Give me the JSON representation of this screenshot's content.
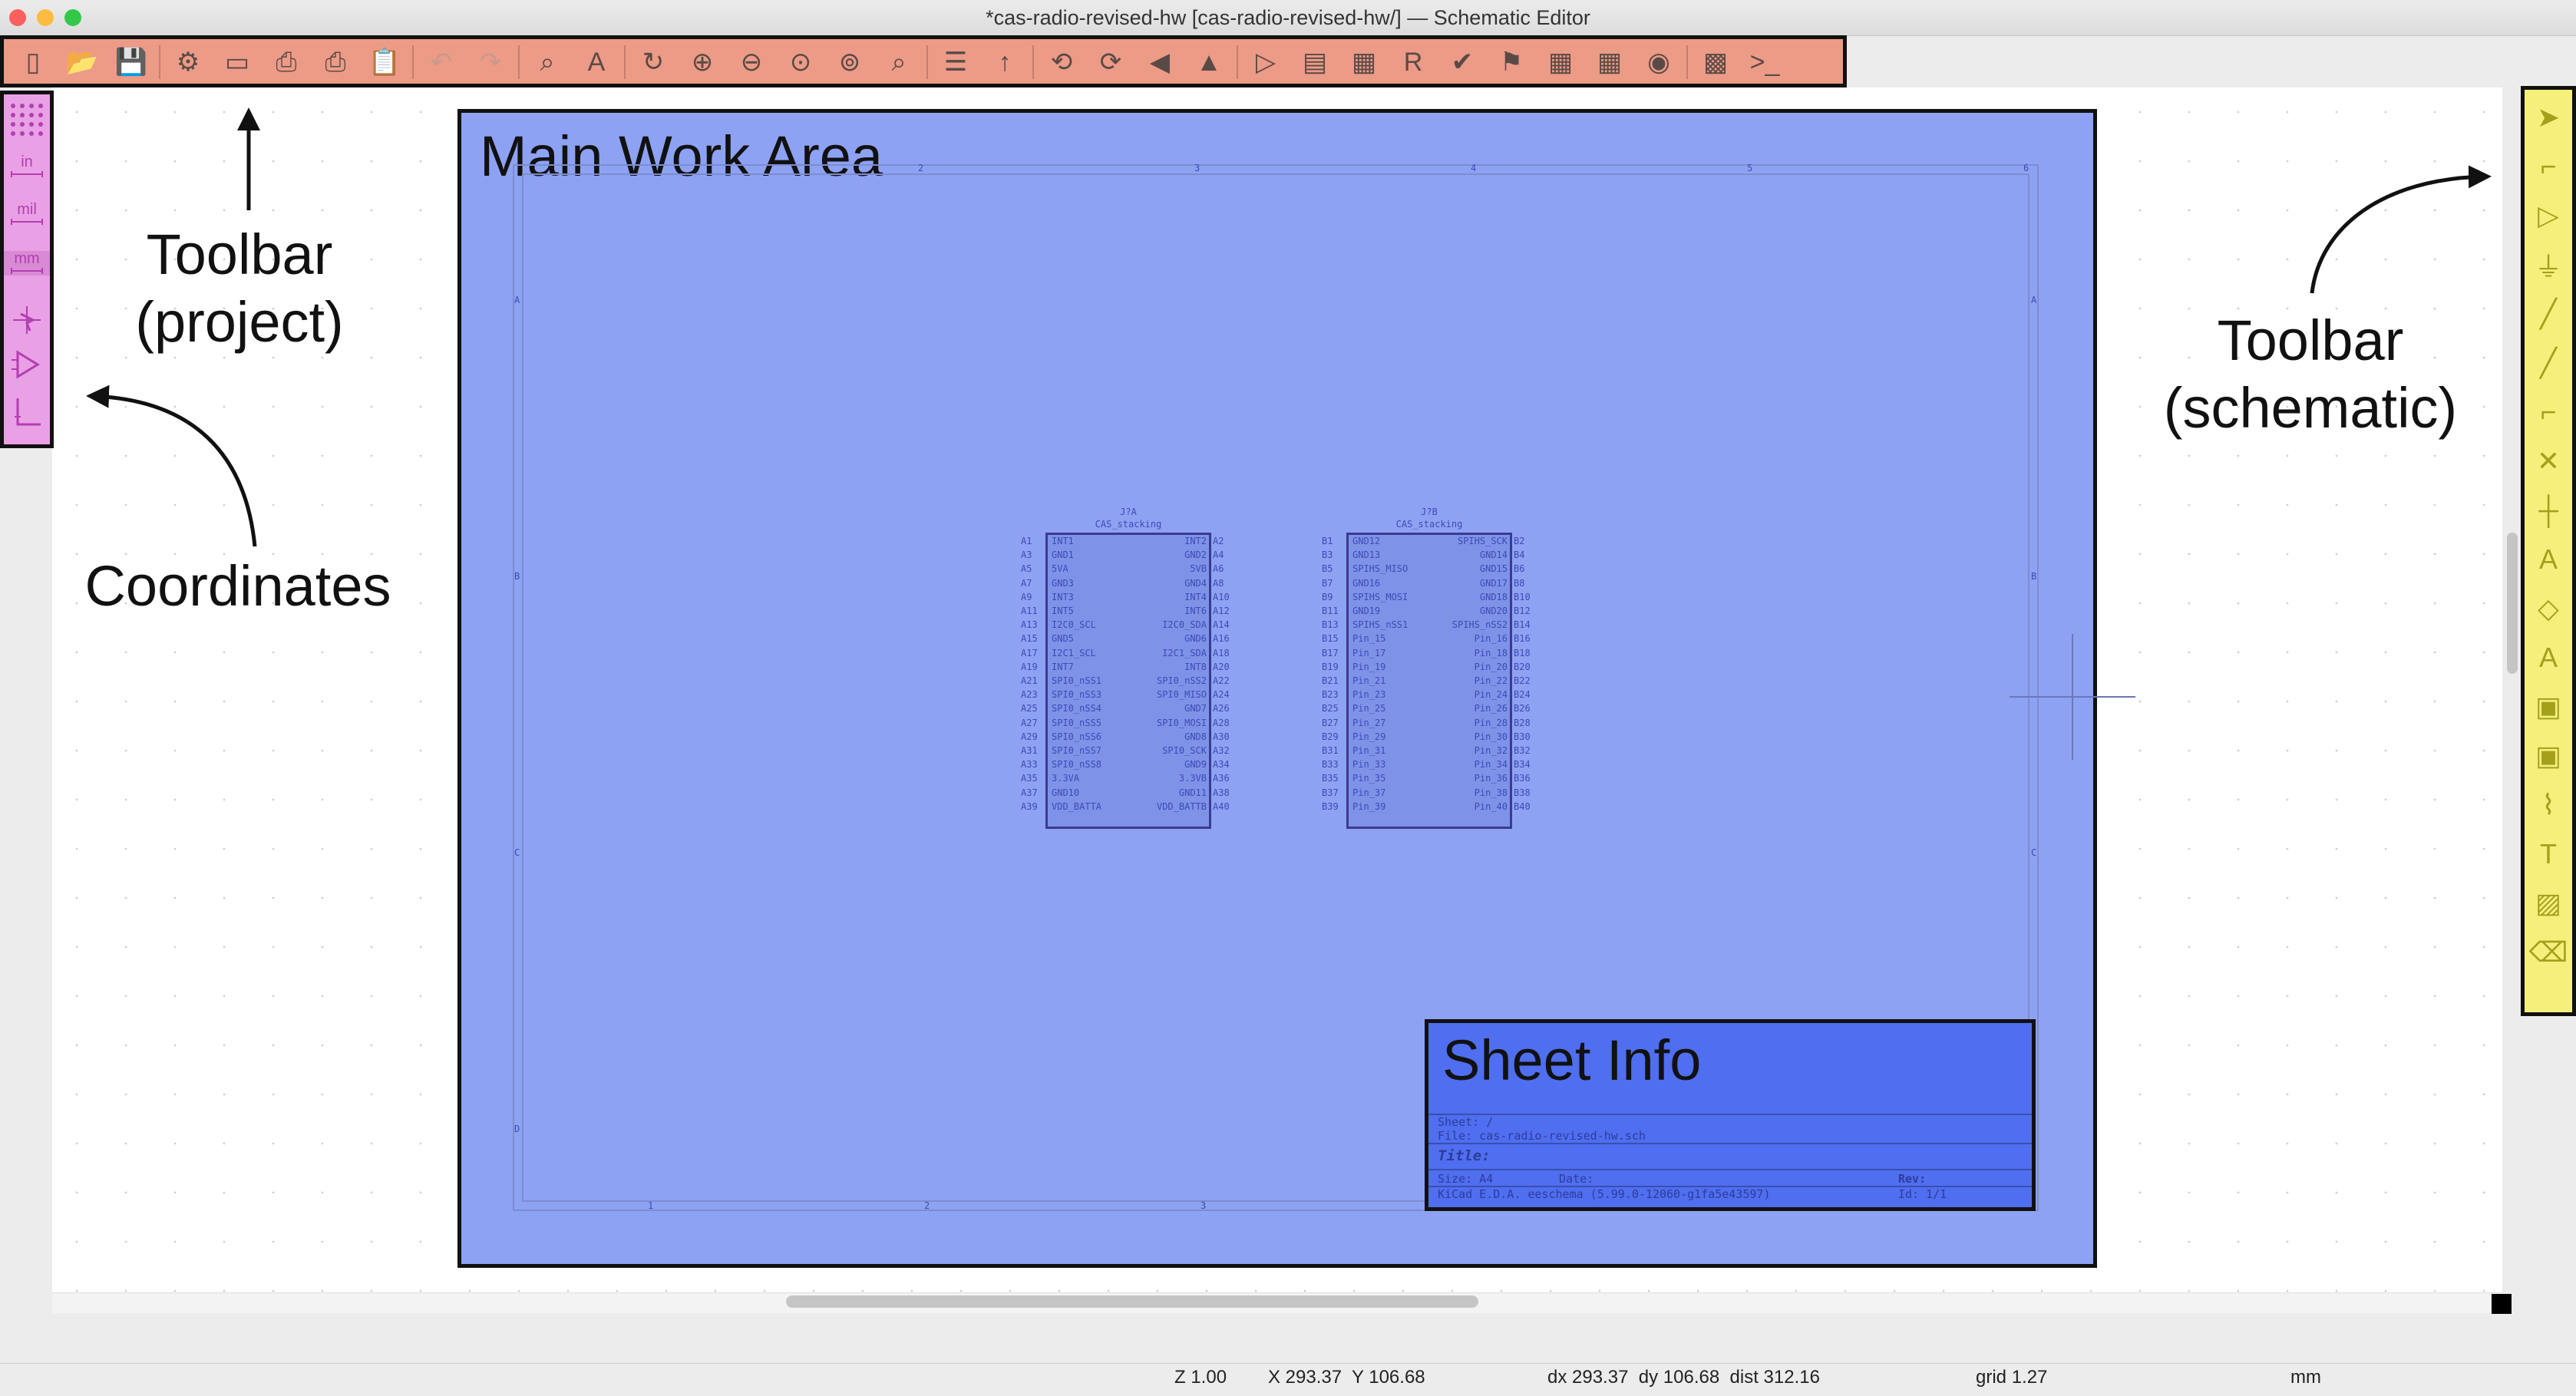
{
  "window": {
    "title": "*cas-radio-revised-hw [cas-radio-revised-hw/] — Schematic Editor"
  },
  "colors": {
    "toolbar_project": "#ec9b87",
    "coordinates_panel": "#eaa0e5",
    "toolbar_schematic": "#f5f07c",
    "main_work_area": "#8ea2f3",
    "sheet_info": "#4f6ef0"
  },
  "toolbar_project": {
    "icons": [
      "new-schematic-icon",
      "open-icon",
      "save-icon",
      "schematic-setup-icon",
      "page-settings-icon",
      "print-icon",
      "plot-icon",
      "paste-icon",
      "undo-icon",
      "redo-icon",
      "find-icon",
      "find-replace-icon",
      "refresh-icon",
      "zoom-in-icon",
      "zoom-out-icon",
      "zoom-fit-icon",
      "zoom-objects-icon",
      "zoom-selection-icon",
      "hierarchy-navigator-icon",
      "leave-sheet-icon",
      "rotate-ccw-icon",
      "rotate-cw-icon",
      "mirror-vertical-icon",
      "mirror-horizontal-icon",
      "symbol-editor-icon",
      "symbol-library-browser-icon",
      "footprint-assignment-icon",
      "annotate-icon",
      "erc-icon",
      "assign-footprints-icon",
      "bom-icon",
      "edit-fields-icon",
      "generate-bom-icon",
      "pcb-editor-icon",
      "scripting-console-icon"
    ]
  },
  "annotations": {
    "main_work_area": "Main Work Area",
    "sheet_info": "Sheet Info",
    "toolbar_project_line1": "Toolbar",
    "toolbar_project_line2": "(project)",
    "toolbar_schematic_line1": "Toolbar",
    "toolbar_schematic_line2": "(schematic)",
    "coordinates": "Coordinates"
  },
  "coordinates_panel": {
    "icons": [
      "grid-toggle-icon",
      "units-inches-icon",
      "units-mils-icon",
      "units-mm-icon",
      "cursor-shape-icon",
      "hidden-pins-icon",
      "wire-angle-icon"
    ],
    "unit_labels": [
      "in",
      "mil",
      "mm"
    ]
  },
  "toolbar_schematic": {
    "icons": [
      "select-icon",
      "highlight-net-icon",
      "add-symbol-icon",
      "add-power-icon",
      "add-wire-icon",
      "add-bus-icon",
      "add-wire-to-bus-entry-icon",
      "no-connect-icon",
      "add-junction-icon",
      "add-label-icon",
      "add-global-label-icon",
      "add-hierarchical-label-icon",
      "add-sheet-icon",
      "import-sheet-pin-icon",
      "add-graphic-lines-icon",
      "add-text-icon",
      "add-image-icon",
      "delete-icon"
    ]
  },
  "sheet_info": {
    "sheet": "Sheet: /",
    "file": "File: cas-radio-revised-hw.sch",
    "title": "Title:",
    "size": "Size: A4",
    "date": "Date:",
    "rev": "Rev:",
    "app": "KiCad E.D.A.  eeschema (5.99.0-12060-g1fa5e43597)",
    "id": "Id: 1/1"
  },
  "components": [
    {
      "ref": "J?A",
      "value": "CAS_stacking",
      "left_pins": [
        "INT1",
        "GND1",
        "5VA",
        "GND3",
        "INT3",
        "INT5",
        "I2C0_SCL",
        "GND5",
        "I2C1_SCL",
        "INT7",
        "SPI0_nSS1",
        "SPI0_nSS3",
        "SPI0_nSS4",
        "SPI0_nSS5",
        "SPI0_nSS6",
        "SPI0_nSS7",
        "SPI0_nSS8",
        "3.3VA",
        "GND10",
        "VDD_BATTA"
      ],
      "right_pins": [
        "INT2",
        "GND2",
        "5VB",
        "GND4",
        "INT4",
        "INT6",
        "I2C0_SDA",
        "GND6",
        "I2C1_SDA",
        "INT8",
        "SPI0_nSS2",
        "SPI0_MISO",
        "GND7",
        "SPI0_MOSI",
        "GND8",
        "SPI0_SCK",
        "GND9",
        "3.3VB",
        "GND11",
        "VDD_BATTB"
      ],
      "left_nums": [
        "A1",
        "A3",
        "A5",
        "A7",
        "A9",
        "A11",
        "A13",
        "A15",
        "A17",
        "A19",
        "A21",
        "A23",
        "A25",
        "A27",
        "A29",
        "A31",
        "A33",
        "A35",
        "A37",
        "A39"
      ],
      "right_nums": [
        "A2",
        "A4",
        "A6",
        "A8",
        "A10",
        "A12",
        "A14",
        "A16",
        "A18",
        "A20",
        "A22",
        "A24",
        "A26",
        "A28",
        "A30",
        "A32",
        "A34",
        "A36",
        "A38",
        "A40"
      ]
    },
    {
      "ref": "J?B",
      "value": "CAS_stacking",
      "left_pins": [
        "GND12",
        "GND13",
        "SPIHS_MISO",
        "GND16",
        "SPIHS_MOSI",
        "GND19",
        "SPIHS_nSS1",
        "Pin_15",
        "Pin_17",
        "Pin_19",
        "Pin_21",
        "Pin_23",
        "Pin_25",
        "Pin_27",
        "Pin_29",
        "Pin_31",
        "Pin_33",
        "Pin_35",
        "Pin_37",
        "Pin_39"
      ],
      "right_pins": [
        "SPIHS_SCK",
        "GND14",
        "GND15",
        "GND17",
        "GND18",
        "GND20",
        "SPIHS_nSS2",
        "Pin_16",
        "Pin_18",
        "Pin_20",
        "Pin_22",
        "Pin_24",
        "Pin_26",
        "Pin_28",
        "Pin_30",
        "Pin_32",
        "Pin_34",
        "Pin_36",
        "Pin_38",
        "Pin_40"
      ],
      "left_nums": [
        "B1",
        "B3",
        "B5",
        "B7",
        "B9",
        "B11",
        "B13",
        "B15",
        "B17",
        "B19",
        "B21",
        "B23",
        "B25",
        "B27",
        "B29",
        "B31",
        "B33",
        "B35",
        "B37",
        "B39"
      ],
      "right_nums": [
        "B2",
        "B4",
        "B6",
        "B8",
        "B10",
        "B12",
        "B14",
        "B16",
        "B18",
        "B20",
        "B22",
        "B24",
        "B26",
        "B28",
        "B30",
        "B32",
        "B34",
        "B36",
        "B38",
        "B40"
      ]
    }
  ],
  "frame_labels": {
    "columns": [
      "1",
      "2",
      "3",
      "4",
      "5",
      "6"
    ],
    "rows": [
      "A",
      "B",
      "C",
      "D"
    ]
  },
  "status": {
    "zoom": "Z 1.00",
    "cursor": "X 293.37  Y 106.68",
    "delta": "dx 293.37  dy 106.68  dist 312.16",
    "grid": "grid 1.27",
    "units": "mm"
  }
}
